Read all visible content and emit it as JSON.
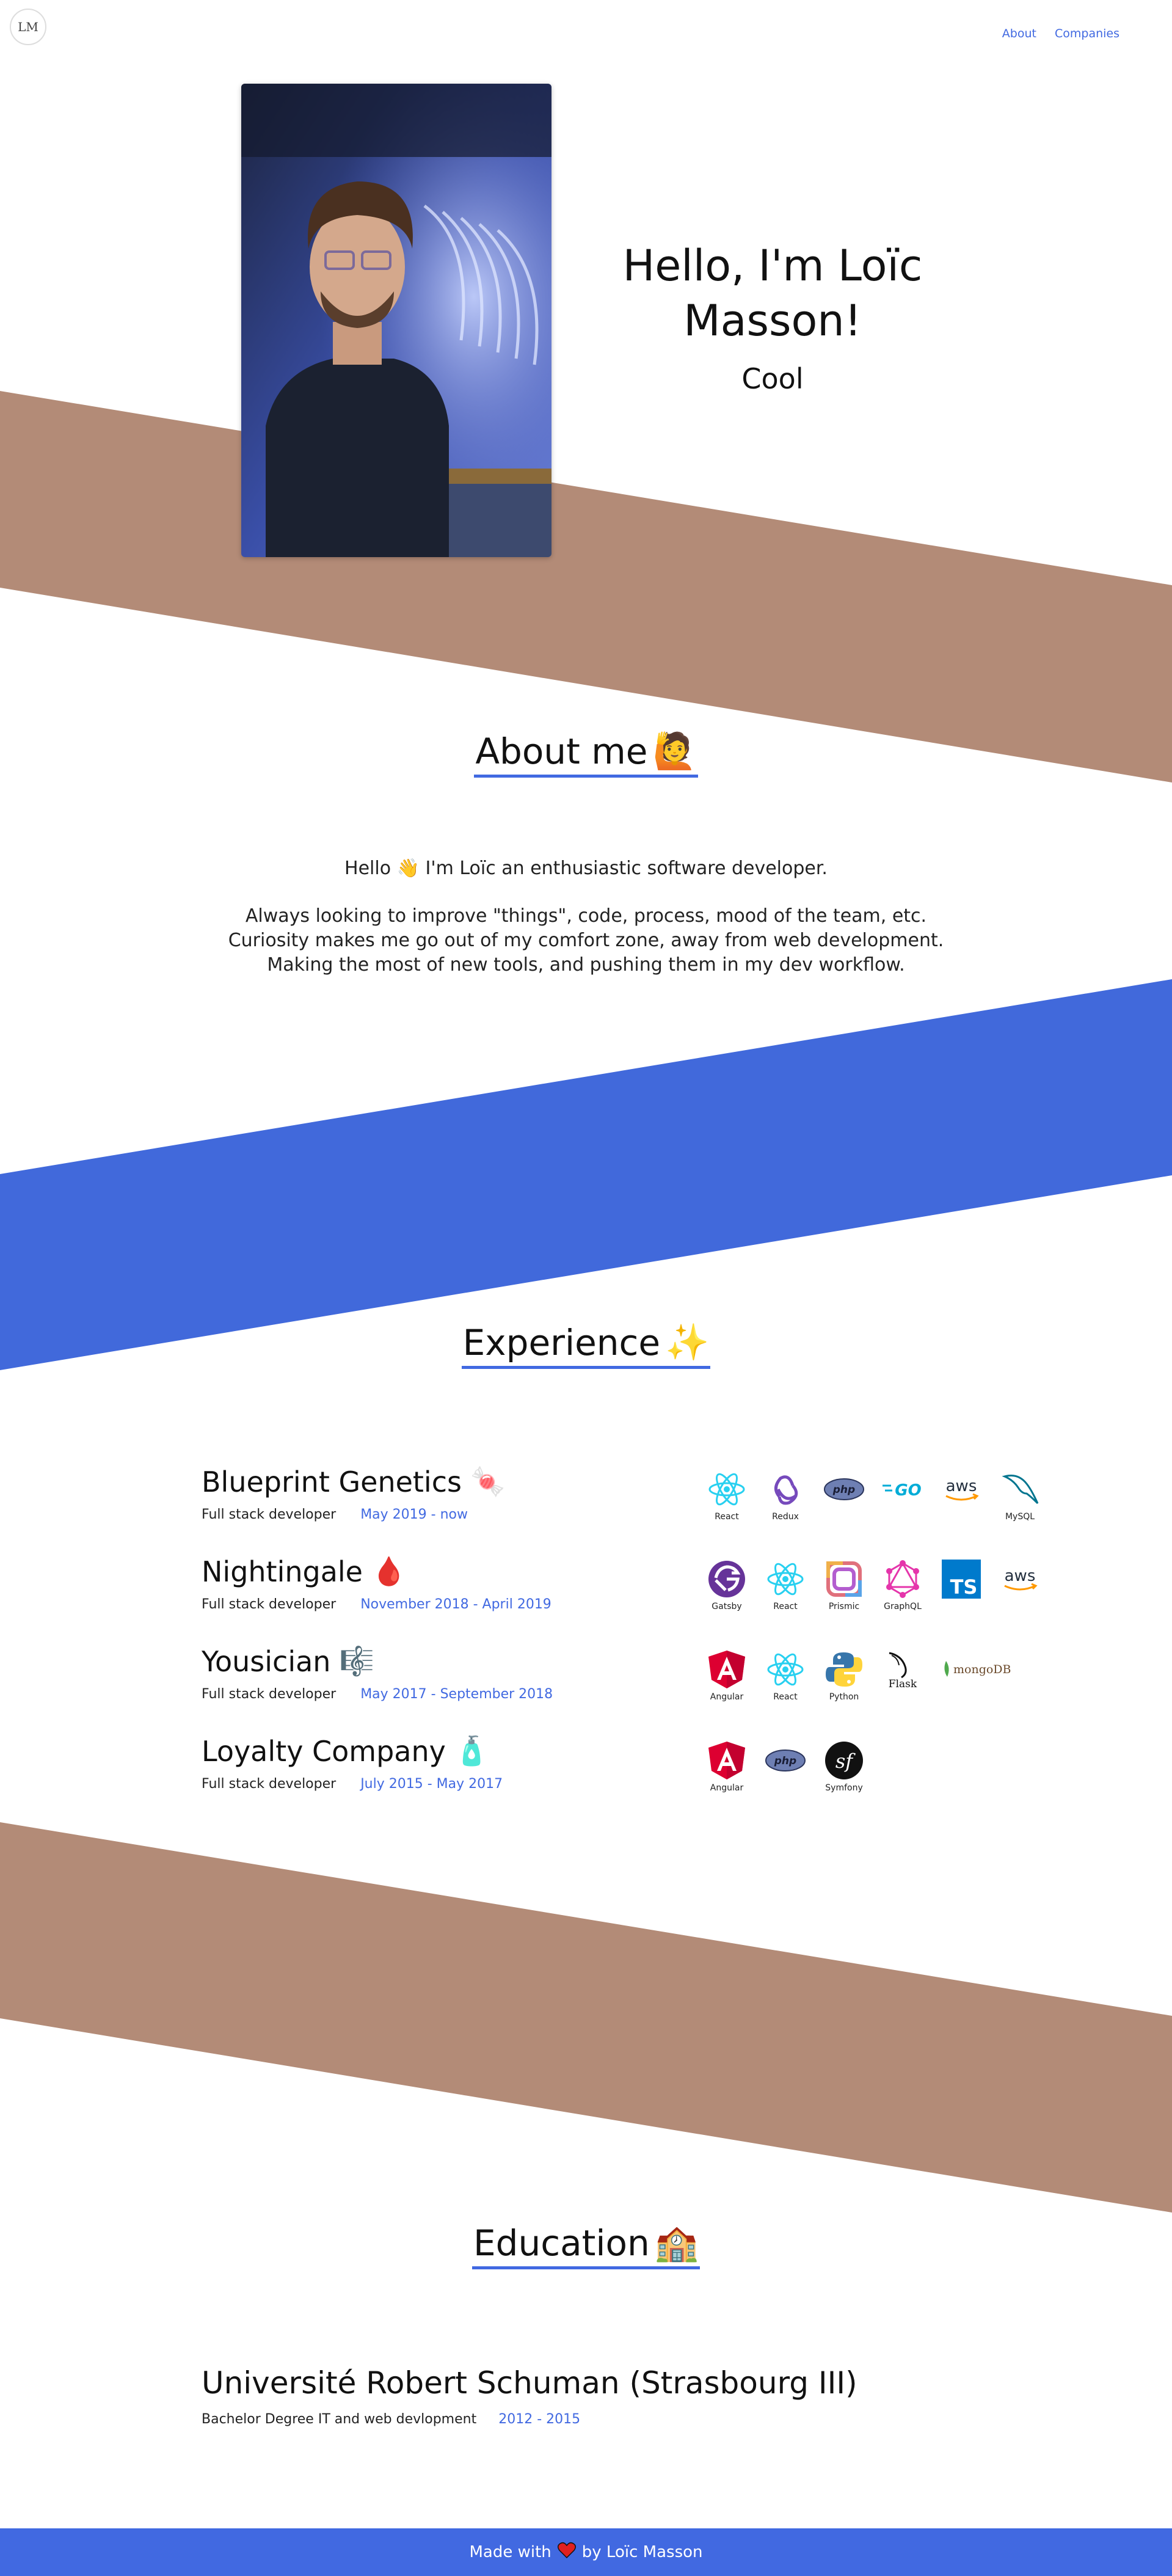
{
  "header": {
    "logo_text": "LM",
    "nav": [
      {
        "label": "About"
      },
      {
        "label": "Companies"
      }
    ]
  },
  "hero": {
    "title": "Hello, I'm Loïc Masson!",
    "subtitle": "Cool",
    "photo_icon": "portrait-photo"
  },
  "about": {
    "heading": "About me",
    "heading_emoji": "🙋",
    "line1_before": "Hello",
    "line1_emoji": "👋",
    "line1_after": "I'm Loïc an enthusiastic software developer.",
    "lines": [
      "Always looking to improve \"things\", code, process, mood of the team, etc.",
      "Curiosity makes me go out of my comfort zone, away from web development.",
      "Making the most of new tools, and pushing them in my dev workflow."
    ]
  },
  "experience": {
    "heading": "Experience",
    "heading_emoji": "✨",
    "jobs": [
      {
        "company": "Blueprint Genetics",
        "emoji": "🍬",
        "role": "Full stack developer",
        "period": "May 2019 - now",
        "tech": [
          {
            "icon": "react-icon",
            "label": "React"
          },
          {
            "icon": "redux-icon",
            "label": "Redux"
          },
          {
            "icon": "php-icon",
            "label": ""
          },
          {
            "icon": "go-icon",
            "label": ""
          },
          {
            "icon": "aws-icon",
            "label": ""
          },
          {
            "icon": "mysql-icon",
            "label": "MySQL"
          }
        ]
      },
      {
        "company": "Nightingale",
        "emoji": "🩸",
        "role": "Full stack developer",
        "period": "November 2018 - April 2019",
        "tech": [
          {
            "icon": "gatsby-icon",
            "label": "Gatsby"
          },
          {
            "icon": "react-icon",
            "label": "React"
          },
          {
            "icon": "prismic-icon",
            "label": "Prismic"
          },
          {
            "icon": "graphql-icon",
            "label": "GraphQL"
          },
          {
            "icon": "typescript-icon",
            "label": ""
          },
          {
            "icon": "aws-icon",
            "label": ""
          }
        ]
      },
      {
        "company": "Yousician",
        "emoji": "🎼",
        "role": "Full stack developer",
        "period": "May 2017 - September 2018",
        "tech": [
          {
            "icon": "angular-icon",
            "label": "Angular"
          },
          {
            "icon": "react-icon",
            "label": "React"
          },
          {
            "icon": "python-icon",
            "label": "Python"
          },
          {
            "icon": "flask-icon",
            "label": ""
          },
          {
            "icon": "mongodb-icon",
            "label": ""
          }
        ]
      },
      {
        "company": "Loyalty Company",
        "emoji": "🧴",
        "role": "Full stack developer",
        "period": "July 2015 - May 2017",
        "tech": [
          {
            "icon": "angular-icon",
            "label": "Angular"
          },
          {
            "icon": "php-icon",
            "label": ""
          },
          {
            "icon": "symfony-icon",
            "label": "Symfony"
          }
        ]
      }
    ]
  },
  "education": {
    "heading": "Education",
    "heading_emoji": "🏫",
    "school": "Université Robert Schuman (Strasbourg III)",
    "degree": "Bachelor Degree IT and web devlopment",
    "period": "2012 - 2015"
  },
  "footer": {
    "before": "Made with",
    "heart_icon": "heart-icon",
    "after": "by Loïc Masson"
  },
  "colors": {
    "accent": "#4169e1",
    "band_brown": "#b38b77",
    "band_blue": "#4169db"
  }
}
